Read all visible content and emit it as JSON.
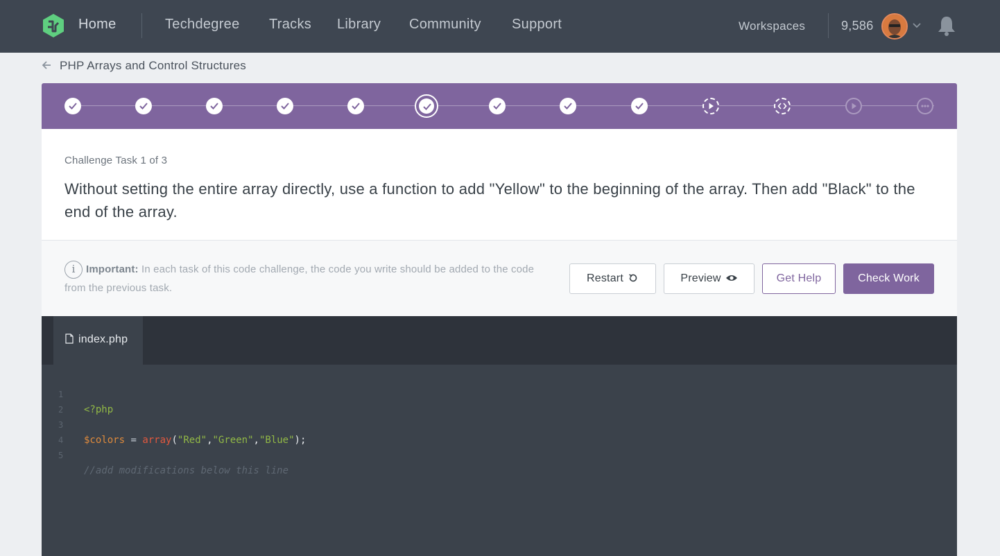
{
  "nav": {
    "home": "Home",
    "links": [
      "Techdegree",
      "Tracks",
      "Library",
      "Community",
      "Support"
    ],
    "workspaces": "Workspaces",
    "points": "9,586"
  },
  "breadcrumb": {
    "title": "PHP Arrays and Control Structures"
  },
  "progress": {
    "steps": [
      "complete",
      "complete",
      "complete",
      "complete",
      "complete",
      "current",
      "complete",
      "complete",
      "complete",
      "video",
      "code-challenge",
      "video-locked",
      "quiz-locked"
    ]
  },
  "challenge": {
    "task_label": "Challenge Task 1 of 3",
    "task_text": "Without setting the entire array directly, use a function to add \"Yellow\" to the beginning of the array. Then add \"Black\" to the end of the array."
  },
  "actions": {
    "important_label": "Important:",
    "important_text": "In each task of this code challenge, the code you write should be added to the code from the previous task.",
    "restart": "Restart",
    "preview": "Preview",
    "get_help": "Get Help",
    "check_work": "Check Work"
  },
  "editor": {
    "file_name": "index.php",
    "line_numbers": [
      "1",
      "2",
      "3",
      "4",
      "5"
    ],
    "lines": {
      "l1": "<?php",
      "l3_var": "$colors",
      "l3_eq": " = ",
      "l3_fn": "array",
      "l3_open": "(",
      "l3_s1": "\"Red\"",
      "l3_c1": ",",
      "l3_s2": "\"Green\"",
      "l3_c2": ",",
      "l3_s3": "\"Blue\"",
      "l3_close": ");",
      "l5": "//add modifications below this line"
    }
  },
  "colors": {
    "nav_bg": "#3e4651",
    "accent_purple": "#7f659e",
    "logo_green": "#5fcf80",
    "editor_bg": "#3b424b"
  }
}
